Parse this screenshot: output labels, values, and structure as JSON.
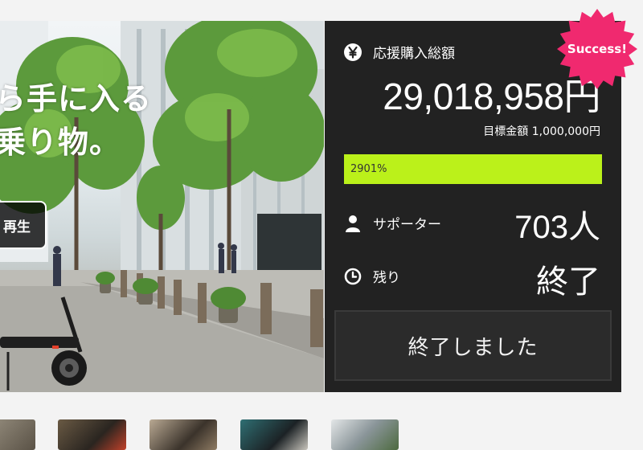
{
  "hero": {
    "line1": "ら手に入る",
    "line2": "乗り物。",
    "play_label": "再生"
  },
  "panel": {
    "total_label": "応援購入総額",
    "total_value": "29,018,958円",
    "goal_text": "目標金額 1,000,000円",
    "progress_text": "2901%",
    "progress_fraction": 1.0,
    "supporters_label": "サポーター",
    "supporters_value": "703人",
    "remaining_label": "残り",
    "remaining_value": "終了",
    "ended_button": "終了しました"
  },
  "badge": {
    "text": "Success!"
  },
  "colors": {
    "panel_bg": "#222222",
    "progress": "#bbf11a",
    "badge": "#f0296f"
  }
}
